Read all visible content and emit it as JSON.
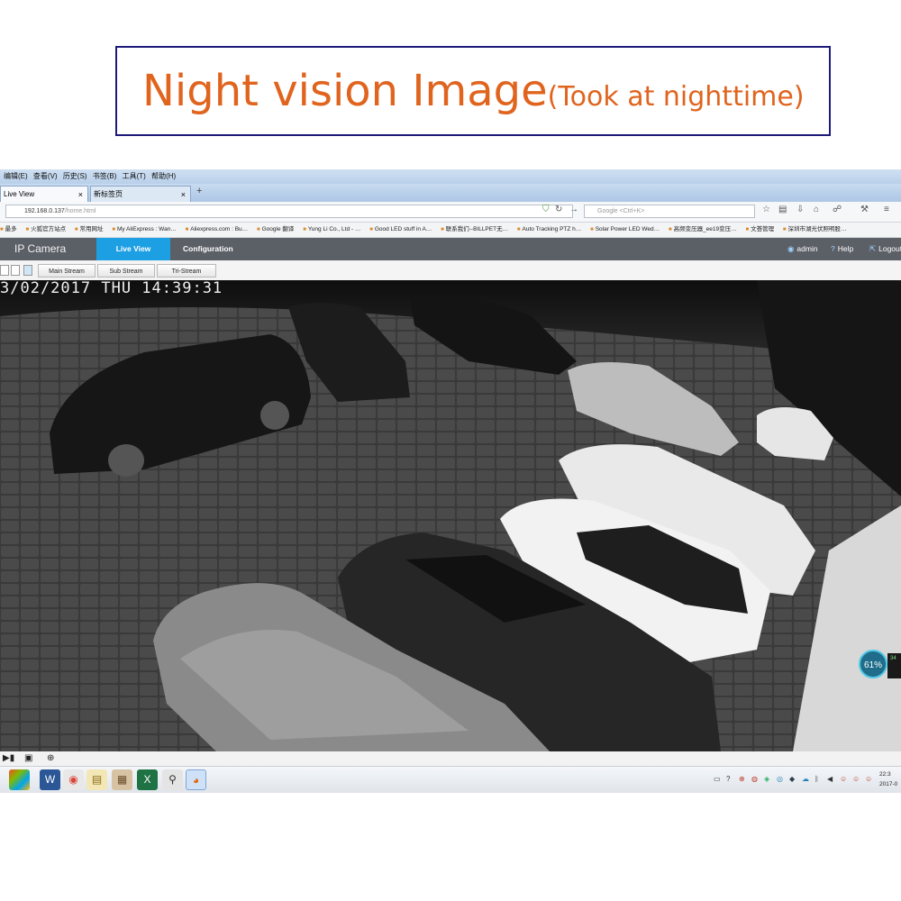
{
  "banner": {
    "main": "Night vision Image",
    "note": "(Took at nighttime)"
  },
  "browser": {
    "menu": [
      "编辑(E)",
      "查看(V)",
      "历史(S)",
      "书签(B)",
      "工具(T)",
      "帮助(H)"
    ],
    "tabs": [
      {
        "label": "Live View"
      },
      {
        "label": "新标签页"
      }
    ],
    "url": {
      "host": "192.168.0.137",
      "path": "/home.html"
    },
    "search_placeholder": "Google <Ctrl+K>",
    "bookmarks": [
      "最多",
      "火狐官方站点",
      "常用网址",
      "My AliExpress : Wan…",
      "Aliexpress.com : Bu…",
      "Google 翻译",
      "Yung Li Co., Ltd - …",
      "Good LED stuff in A…",
      "联系我们--BILLPET无…",
      "Auto Tracking PTZ h…",
      "Solar Power LED Wed…",
      "高频变压器_ee19变压…",
      "文荟管理",
      "深圳市湖光伏照明股…"
    ]
  },
  "app": {
    "title": "IP Camera",
    "tabs": {
      "live": "Live View",
      "config": "Configuration"
    },
    "header_right": {
      "admin": "admin",
      "help": "Help",
      "logout": "Logout"
    },
    "streams": [
      "Main Stream",
      "Sub Stream",
      "Tri-Stream"
    ]
  },
  "video": {
    "osd": "3/02/2017 THU 14:39:31",
    "badge": "61%",
    "badge_side": "34"
  },
  "taskbar": {
    "clock_time": "22:3",
    "clock_date": "2017-0"
  },
  "colors": {
    "accent": "#1d9fe3",
    "title_orange": "#e0641e",
    "banner_border": "#1e1a7a",
    "header_bg": "#5b5f66"
  }
}
